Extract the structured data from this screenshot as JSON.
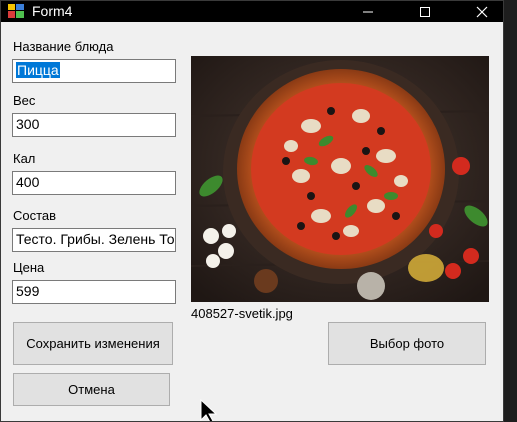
{
  "window": {
    "title": "Form4"
  },
  "fields": [
    {
      "label": "Название блюда",
      "value": "Пицца"
    },
    {
      "label": "Вес",
      "value": "300"
    },
    {
      "label": "Кал",
      "value": "400"
    },
    {
      "label": "Состав",
      "value": "Тесто. Грибы. Зелень То"
    },
    {
      "label": "Цена",
      "value": "599"
    }
  ],
  "photo": {
    "filename": "408527-svetik.jpg"
  },
  "buttons": {
    "save": "Сохранить изменения",
    "choose_photo": "Выбор фото",
    "cancel": "Отмена"
  },
  "colors": {
    "selection": "#0078d7",
    "titlebar": "#000000",
    "form_bg": "#f0f0f0"
  }
}
